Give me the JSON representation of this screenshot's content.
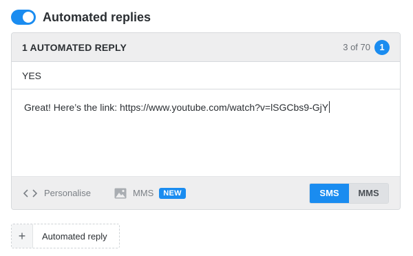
{
  "colors": {
    "accent": "#1a8cf0"
  },
  "automated_replies": {
    "toggle_on": true,
    "title": "Automated replies"
  },
  "reply_card": {
    "heading": "1 AUTOMATED REPLY",
    "counter_text": "3 of 70",
    "counter_badge": "1",
    "keyword": "YES",
    "message": "Great! Here’s the link: https://www.youtube.com/watch?v=lSGCbs9-GjY",
    "toolbar": {
      "personalise_icon": "code-brackets-icon",
      "personalise_label": "Personalise",
      "mms_icon": "image-icon",
      "mms_label": "MMS",
      "new_badge": "NEW"
    },
    "message_type": {
      "options": [
        "SMS",
        "MMS"
      ],
      "selected": "SMS"
    }
  },
  "add_button": {
    "icon": "+",
    "label": "Automated reply"
  }
}
